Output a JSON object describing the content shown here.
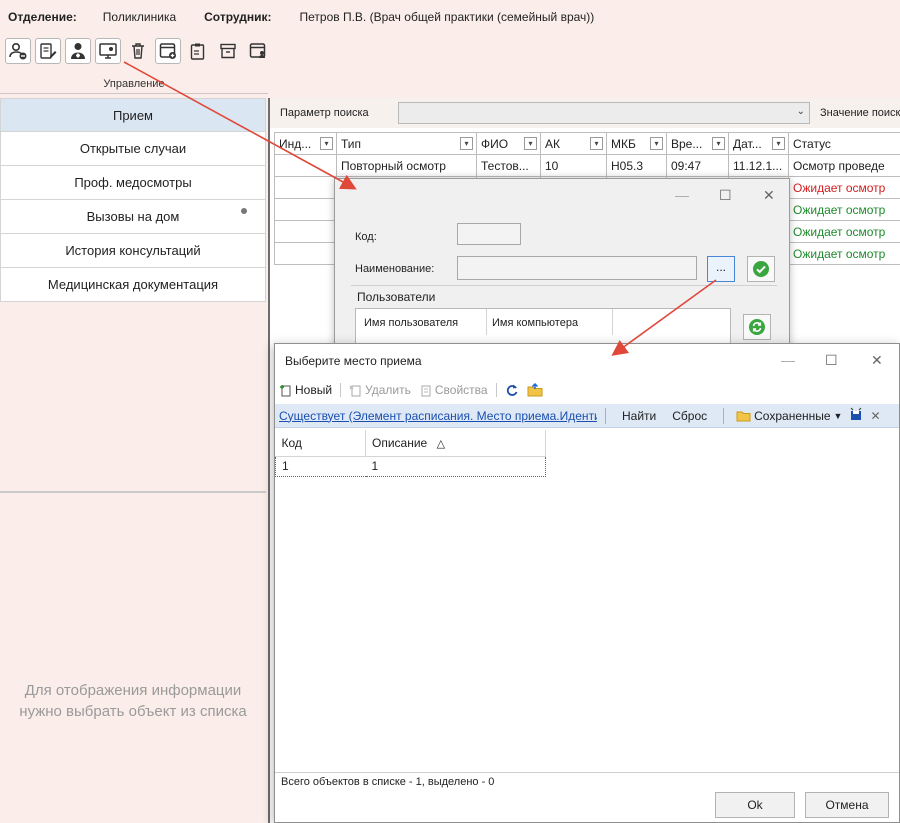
{
  "header": {
    "dept_label": "Отделение:",
    "dept_value": "Поликлиника",
    "staff_label": "Сотрудник:",
    "staff_value": "Петров П.В. (Врач общей практики (семейный врач))"
  },
  "toolbar": {
    "caption": "Управление"
  },
  "nav": {
    "items": [
      {
        "label": "Прием"
      },
      {
        "label": "Открытые случаи"
      },
      {
        "label": "Проф. медосмотры"
      },
      {
        "label": "Вызовы на дом"
      },
      {
        "label": "История консультаций"
      },
      {
        "label": "Медицинская документация"
      }
    ]
  },
  "left_info": {
    "line1": "Для отображения информации",
    "line2": "нужно выбрать объект из списка"
  },
  "search": {
    "param_label": "Параметр поиска",
    "value_label": "Значение поиск"
  },
  "grid": {
    "columns": [
      "Инд...",
      "Тип",
      "ФИО",
      "АК",
      "МКБ",
      "Вре...",
      "Дат...",
      "Статус"
    ],
    "rows": [
      [
        "",
        "Повторный осмотр",
        "Тестов...",
        "10",
        "H05.3",
        "09:47",
        "11.12.1...",
        "Осмотр проведе"
      ],
      [
        "",
        "",
        "",
        "",
        "",
        "",
        "",
        "Ожидает осмотр"
      ],
      [
        "",
        "",
        "",
        "",
        "",
        "",
        "",
        "Ожидает осмотр"
      ],
      [
        "",
        "",
        "",
        "",
        "",
        "",
        "",
        "Ожидает осмотр"
      ],
      [
        "",
        "",
        "",
        "",
        "",
        "",
        "",
        "Ожидает осмотр"
      ]
    ]
  },
  "dialog1": {
    "code_label": "Код:",
    "name_label": "Наименование:",
    "dots": "...",
    "users_group": "Пользователи",
    "col_user": "Имя пользователя",
    "col_computer": "Имя компьютера"
  },
  "dialog2": {
    "title": "Выберите место приема",
    "tools": {
      "new": "Новый",
      "delete": "Удалить",
      "props": "Свойства"
    },
    "filter": {
      "link": "Существует (Элемент расписания. Место приема.Идентис",
      "find": "Найти",
      "reset": "Сброс",
      "saved": "Сохраненные"
    },
    "columns": [
      "Код",
      "Описание"
    ],
    "rows": [
      [
        "1",
        "1"
      ]
    ],
    "status": "Всего объектов в списке - 1, выделено - 0",
    "ok": "Ok",
    "cancel": "Отмена"
  },
  "colors": {
    "background": "#fbeeea",
    "arrow": "#e0483a",
    "status_red": "#d41e1e",
    "status_green": "#1e8a2b"
  }
}
